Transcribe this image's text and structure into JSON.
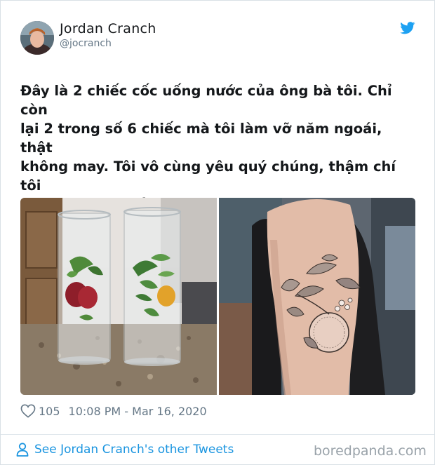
{
  "author": {
    "name": "Jordan Cranch",
    "handle": "@jocranch"
  },
  "tweet": {
    "text": "Đây là 2 chiếc cốc uống nước của ông bà tôi. Chỉ còn\nlại 2 trong số 6 chiếc mà tôi làm vỡ năm ngoái, thật\nkhông may.  Tôi vô cùng yêu quý chúng, thậm chí tôi\nđã xăm hình quả cam lên tay này!",
    "likes": "105",
    "timestamp": "10:08 PM - Mar 16, 2020"
  },
  "footer": {
    "link_label": "See Jordan Cranch's other Tweets"
  },
  "watermark": "boredpanda.com",
  "icons": {
    "platform": "twitter-bird-icon",
    "like": "heart-icon",
    "profile": "person-icon"
  },
  "colors": {
    "twitter_blue": "#1da1f2",
    "link_blue": "#1b95e0",
    "muted_gray": "#657786"
  }
}
